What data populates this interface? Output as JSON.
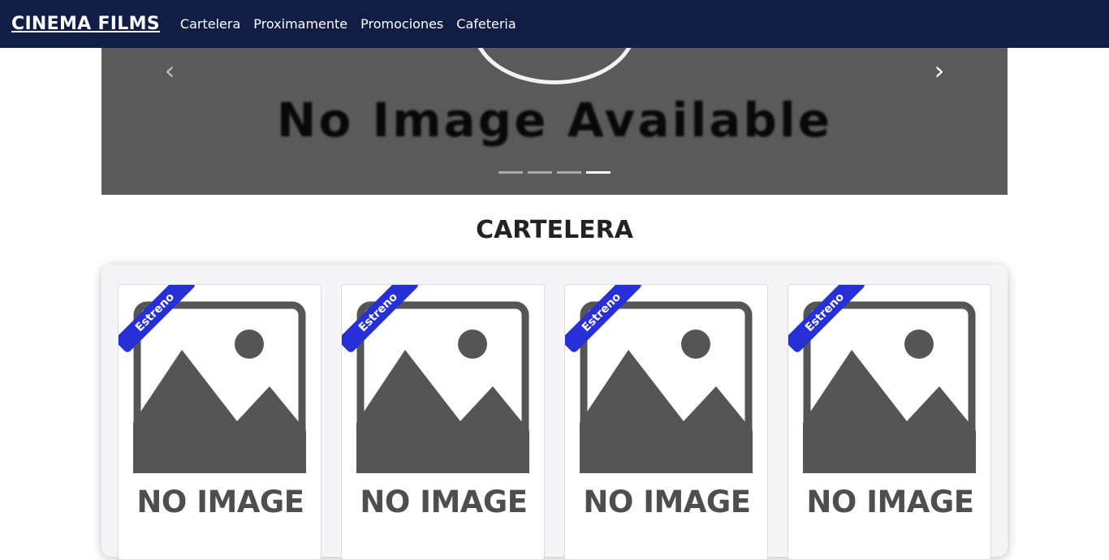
{
  "navbar": {
    "brand": "CINEMA FILMS",
    "links": [
      "Cartelera",
      "Proximamente",
      "Promociones",
      "Cafeteria"
    ]
  },
  "carousel": {
    "image_text": "No Image Available",
    "prev_icon": "chevron-left-icon",
    "next_icon": "chevron-right-icon",
    "slide_count": 4,
    "active_slide": 4
  },
  "section": {
    "title": "CARTELERA"
  },
  "movies": [
    {
      "badge": "Estreno",
      "image_text": "NO IMAGE"
    },
    {
      "badge": "Estreno",
      "image_text": "NO IMAGE"
    },
    {
      "badge": "Estreno",
      "image_text": "NO IMAGE"
    },
    {
      "badge": "Estreno",
      "image_text": "NO IMAGE"
    }
  ],
  "colors": {
    "navbar": "#101d45",
    "ribbon": "#2730d6",
    "placeholder_gray": "#4e4e4e"
  }
}
